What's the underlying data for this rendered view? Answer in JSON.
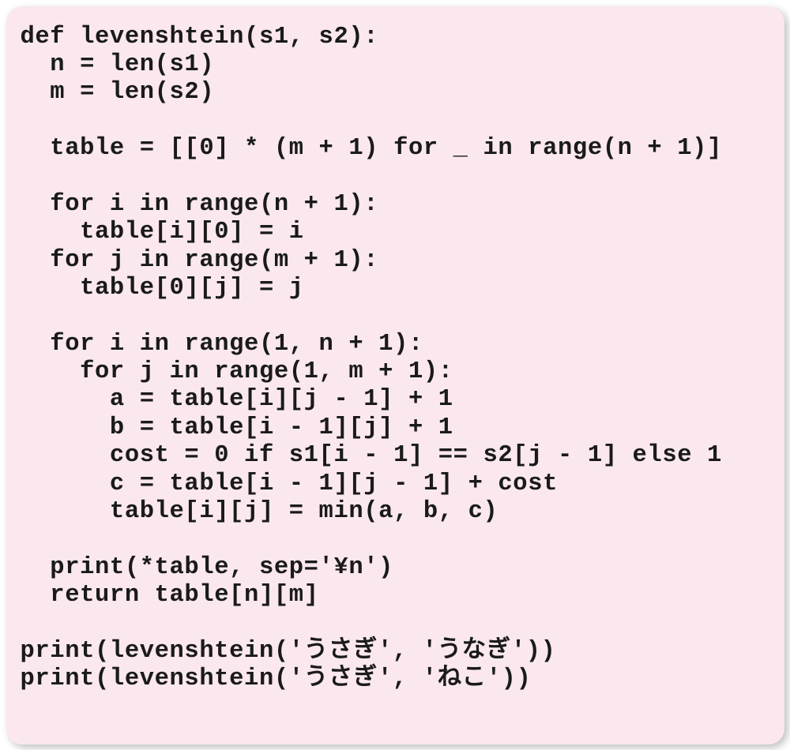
{
  "code": {
    "lines": [
      "def levenshtein(s1, s2):",
      "  n = len(s1)",
      "  m = len(s2)",
      "",
      "  table = [[0] * (m + 1) for _ in range(n + 1)]",
      "",
      "  for i in range(n + 1):",
      "    table[i][0] = i",
      "  for j in range(m + 1):",
      "    table[0][j] = j",
      "",
      "  for i in range(1, n + 1):",
      "    for j in range(1, m + 1):",
      "      a = table[i][j - 1] + 1",
      "      b = table[i - 1][j] + 1",
      "      cost = 0 if s1[i - 1] == s2[j - 1] else 1",
      "      c = table[i - 1][j - 1] + cost",
      "      table[i][j] = min(a, b, c)",
      "",
      "  print(*table, sep='¥n')",
      "  return table[n][m]",
      "",
      "print(levenshtein('うさぎ', 'うなぎ'))",
      "print(levenshtein('うさぎ', 'ねこ'))"
    ]
  }
}
